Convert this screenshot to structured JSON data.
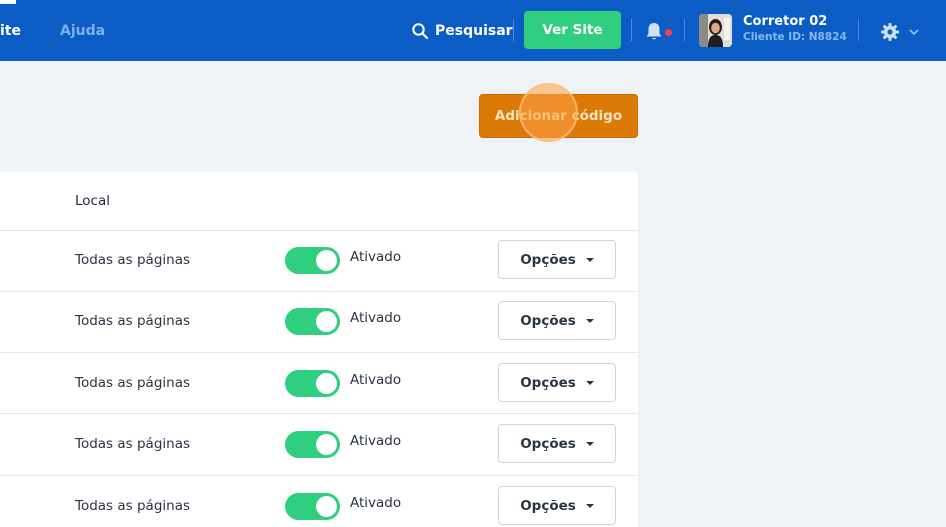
{
  "topbar": {
    "nav": [
      {
        "label": "ite"
      },
      {
        "label": "Ajuda"
      }
    ],
    "search_label": "Pesquisar",
    "ver_site_label": "Ver Site",
    "notification_indicator": true,
    "user": {
      "name": "Corretor 02",
      "client_id": "Cliente ID: N8824"
    },
    "settings_icon": "gear-icon",
    "colors": {
      "bar": "#0b5cc4",
      "ver_site": "#2fcf7f",
      "notification_dot": "#ff3b4d"
    }
  },
  "main": {
    "add_code_label": "Adicionar código",
    "add_code_color": "#dc7a07",
    "table": {
      "columns": [
        "Local"
      ],
      "rows": [
        {
          "local": "Todas as páginas",
          "status": "Ativado",
          "enabled": true,
          "options_label": "Opções"
        },
        {
          "local": "Todas as páginas",
          "status": "Ativado",
          "enabled": true,
          "options_label": "Opções"
        },
        {
          "local": "Todas as páginas",
          "status": "Ativado",
          "enabled": true,
          "options_label": "Opções"
        },
        {
          "local": "Todas as páginas",
          "status": "Ativado",
          "enabled": true,
          "options_label": "Opções"
        },
        {
          "local": "Todas as páginas",
          "status": "Ativado",
          "enabled": true,
          "options_label": "Opções"
        }
      ],
      "toggle_color": "#2fcf7f"
    }
  }
}
